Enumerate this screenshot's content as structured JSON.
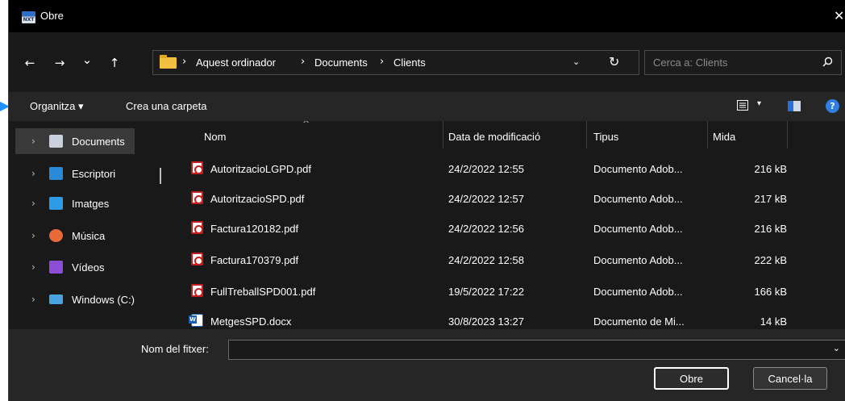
{
  "window": {
    "title": "Obre",
    "app_icon_text": "NXT",
    "close_glyph": "✕"
  },
  "nav": {
    "back_glyph": "←",
    "forward_glyph": "→",
    "recent_glyph": "⌄",
    "up_glyph": "↑",
    "breadcrumb": [
      "Aquest ordinador",
      "Documents",
      "Clients"
    ],
    "breadcrumb_sep": "›",
    "dropdown_glyph": "⌄",
    "refresh_glyph": "↻",
    "search_placeholder": "Cerca a: Clients"
  },
  "toolbar": {
    "organize_label": "Organitza ▾",
    "new_folder_label": "Crea una carpeta",
    "view_dd_glyph": "▾",
    "help_label": "?"
  },
  "sidebar": {
    "chevron": "›",
    "items": [
      {
        "label": "Documents",
        "icon": "documents-icon",
        "color": "#c9d1dc",
        "selected": true
      },
      {
        "label": "Escriptori",
        "icon": "desktop-icon",
        "color": "#2a8ad8",
        "selected": false
      },
      {
        "label": "Imatges",
        "icon": "pictures-icon",
        "color": "#2d9be6",
        "selected": false
      },
      {
        "label": "Música",
        "icon": "music-icon",
        "color": "#e86a3a",
        "selected": false
      },
      {
        "label": "Vídeos",
        "icon": "videos-icon",
        "color": "#8a4fd6",
        "selected": false
      },
      {
        "label": "Windows (C:)",
        "icon": "drive-icon",
        "color": "#4aa3df",
        "selected": false
      }
    ]
  },
  "files": {
    "columns": {
      "name": "Nom",
      "modified": "Data de modificació",
      "type": "Tipus",
      "size": "Mida"
    },
    "sort_glyph": "^",
    "rows": [
      {
        "name": "AutoritzacioLGPD.pdf",
        "modified": "24/2/2022 12:55",
        "type": "Documento Adob...",
        "size": "216 kB",
        "kind": "pdf"
      },
      {
        "name": "AutoritzacioSPD.pdf",
        "modified": "24/2/2022 12:57",
        "type": "Documento Adob...",
        "size": "217 kB",
        "kind": "pdf"
      },
      {
        "name": "Factura120182.pdf",
        "modified": "24/2/2022 12:56",
        "type": "Documento Adob...",
        "size": "216 kB",
        "kind": "pdf"
      },
      {
        "name": "Factura170379.pdf",
        "modified": "24/2/2022 12:58",
        "type": "Documento Adob...",
        "size": "222 kB",
        "kind": "pdf"
      },
      {
        "name": "FullTreballSPD001.pdf",
        "modified": "19/5/2022 17:22",
        "type": "Documento Adob...",
        "size": "166 kB",
        "kind": "pdf"
      },
      {
        "name": "MetgesSPD.docx",
        "modified": "30/8/2023 13:27",
        "type": "Documento de Mi...",
        "size": "14 kB",
        "kind": "doc"
      }
    ]
  },
  "footer": {
    "filename_label": "Nom del fitxer:",
    "filename_value": "",
    "dropdown_glyph": "⌄",
    "open_label": "Obre",
    "cancel_label": "Cancel·la"
  },
  "colors": {
    "window_bg": "#191919",
    "toolbar_bg": "#262626",
    "accent": "#2f7fe0"
  }
}
